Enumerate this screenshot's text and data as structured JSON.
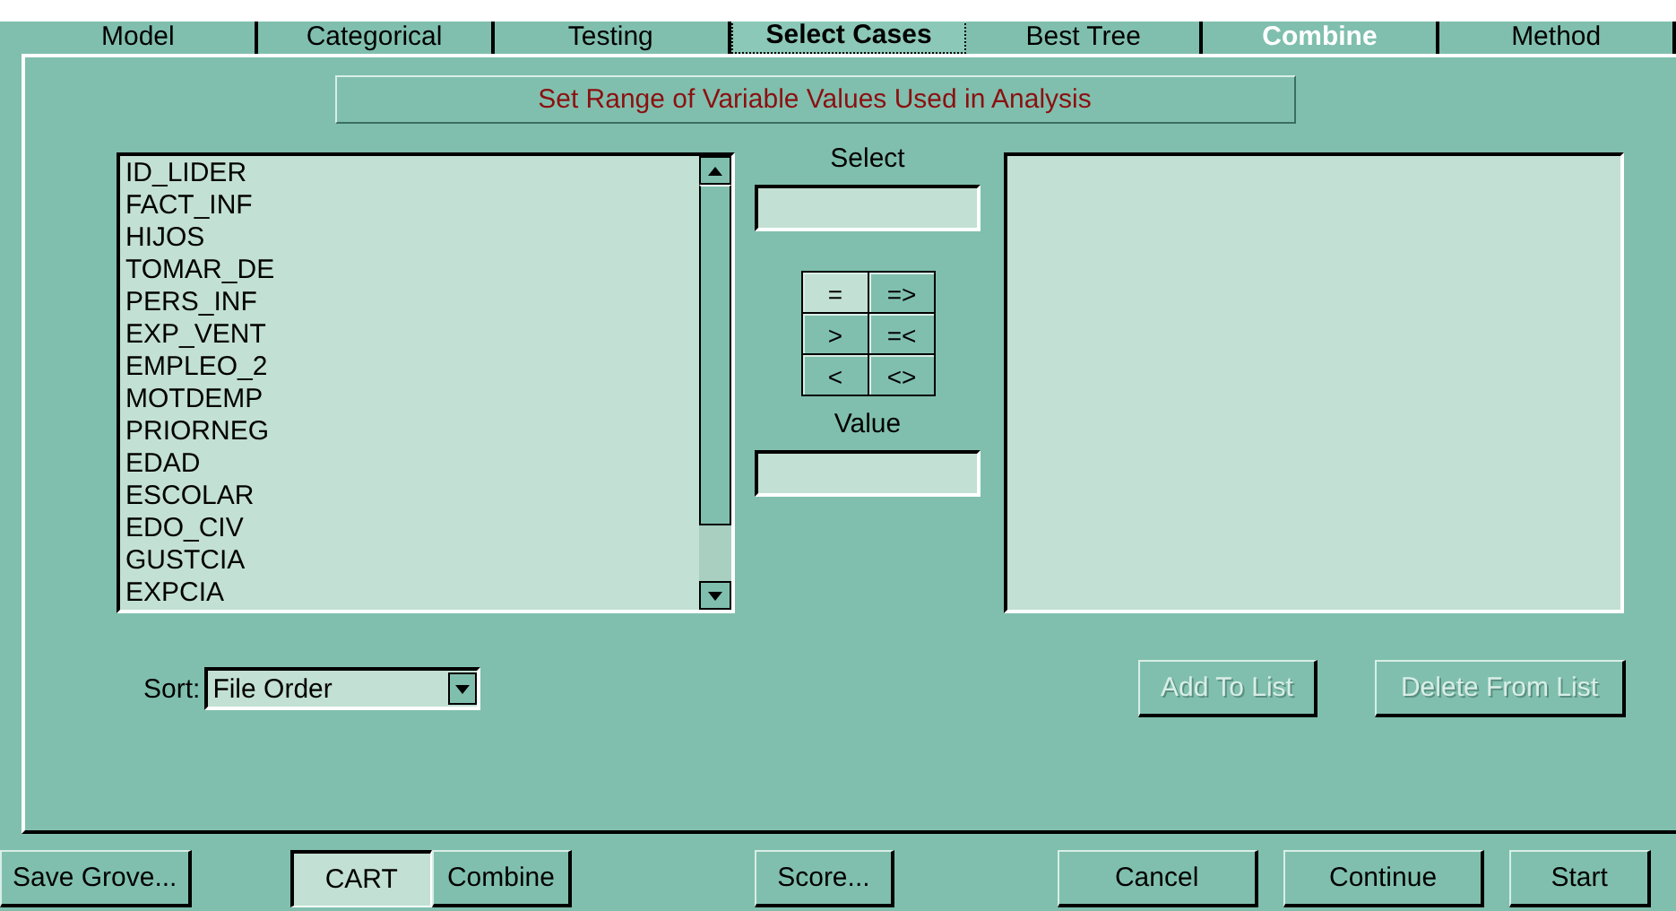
{
  "tabs": [
    {
      "label": "Model",
      "selected": false,
      "highlighted": false
    },
    {
      "label": "Categorical",
      "selected": false,
      "highlighted": false
    },
    {
      "label": "Testing",
      "selected": false,
      "highlighted": false
    },
    {
      "label": "Select Cases",
      "selected": true,
      "highlighted": false
    },
    {
      "label": "Best Tree",
      "selected": false,
      "highlighted": false
    },
    {
      "label": "Combine",
      "selected": false,
      "highlighted": true
    },
    {
      "label": "Method",
      "selected": false,
      "highlighted": false
    }
  ],
  "heading": "Set Range of Variable Values Used in Analysis",
  "variables": [
    "ID_LIDER",
    "FACT_INF",
    "HIJOS",
    "TOMAR_DE",
    "PERS_INF",
    "EXP_VENT",
    "EMPLEO_2",
    "MOTDEMP",
    "PRIORNEG",
    "EDAD",
    "ESCOLAR",
    "EDO_CIV",
    "GUSTCIA",
    "EXPCIA"
  ],
  "select_label": "Select",
  "operators": [
    {
      "label": "=",
      "selected": true
    },
    {
      "label": "=>",
      "selected": false
    },
    {
      "label": ">",
      "selected": false
    },
    {
      "label": "=<",
      "selected": false
    },
    {
      "label": "<",
      "selected": false
    },
    {
      "label": "<>",
      "selected": false
    }
  ],
  "value_label": "Value",
  "sort": {
    "label": "Sort:",
    "value": "File Order"
  },
  "list_buttons": [
    {
      "label": "Add To List",
      "disabled": true
    },
    {
      "label": "Delete From List",
      "disabled": true
    }
  ],
  "footer": {
    "save": "Save Grove...",
    "modes": [
      {
        "label": "CART",
        "selected": true
      },
      {
        "label": "Combine",
        "selected": false
      }
    ],
    "score": "Score...",
    "actions": [
      "Cancel",
      "Continue",
      "Start"
    ]
  }
}
